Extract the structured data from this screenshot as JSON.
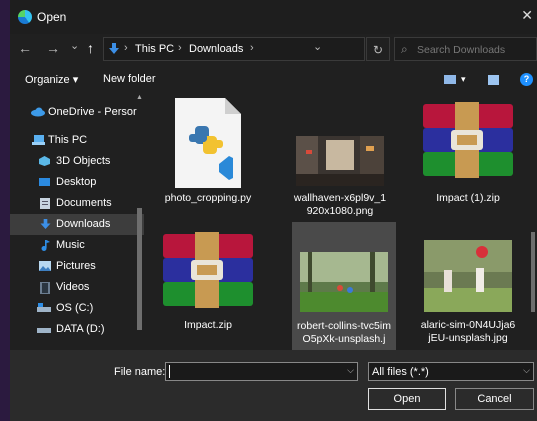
{
  "window": {
    "title": "Open",
    "close_glyph": "✕",
    "accent": "#1e90ff"
  },
  "nav": {
    "back_glyph": "←",
    "forward_glyph": "→",
    "recent_glyph": "⌄",
    "up_glyph": "↑",
    "path_separator": "›",
    "breadcrumb": [
      "This PC",
      "Downloads"
    ],
    "address_dropdown_glyph": "⌄",
    "refresh_glyph": "↻",
    "search_placeholder": "Search Downloads",
    "search_icon": "⌕"
  },
  "toolbar": {
    "organize_label": "Organize ▾",
    "new_folder_label": "New folder",
    "view_dropdown_glyph": "▾",
    "help_glyph": "?"
  },
  "sidebar": {
    "items": [
      {
        "label": "OneDrive - Persor",
        "icon": "cloud-icon"
      },
      {
        "label": "This PC",
        "icon": "computer-icon"
      },
      {
        "label": "3D Objects",
        "icon": "cube-icon"
      },
      {
        "label": "Desktop",
        "icon": "desktop-icon"
      },
      {
        "label": "Documents",
        "icon": "document-icon"
      },
      {
        "label": "Downloads",
        "icon": "download-icon",
        "selected": true
      },
      {
        "label": "Music",
        "icon": "music-icon"
      },
      {
        "label": "Pictures",
        "icon": "pictures-icon"
      },
      {
        "label": "Videos",
        "icon": "video-icon"
      },
      {
        "label": "OS (C:)",
        "icon": "drive-icon"
      },
      {
        "label": "DATA (D:)",
        "icon": "drive-icon"
      }
    ],
    "scroll_up_glyph": "▲"
  },
  "files": [
    {
      "name": "photo_cropping.py",
      "kind": "python-file-icon"
    },
    {
      "name": "wallhaven-x6pl9v_1920x1080.png",
      "kind": "city-street-image"
    },
    {
      "name": "Impact (1).zip",
      "kind": "winrar-archive-icon"
    },
    {
      "name": "Impact.zip",
      "kind": "winrar-archive-icon"
    },
    {
      "name": "robert-collins-tvc5imO5pXk-unsplash.j",
      "kind": "forest-children-image",
      "highlighted": true
    },
    {
      "name": "alaric-sim-0N4UJja6jEU-unsplash.jpg",
      "kind": "kids-balloon-image"
    }
  ],
  "footer": {
    "filename_label": "File name:",
    "filename_value": "",
    "filetype_value": "All files (*.*)",
    "dropdown_glyph": "⌵",
    "open_label": "Open",
    "cancel_label": "Cancel"
  }
}
